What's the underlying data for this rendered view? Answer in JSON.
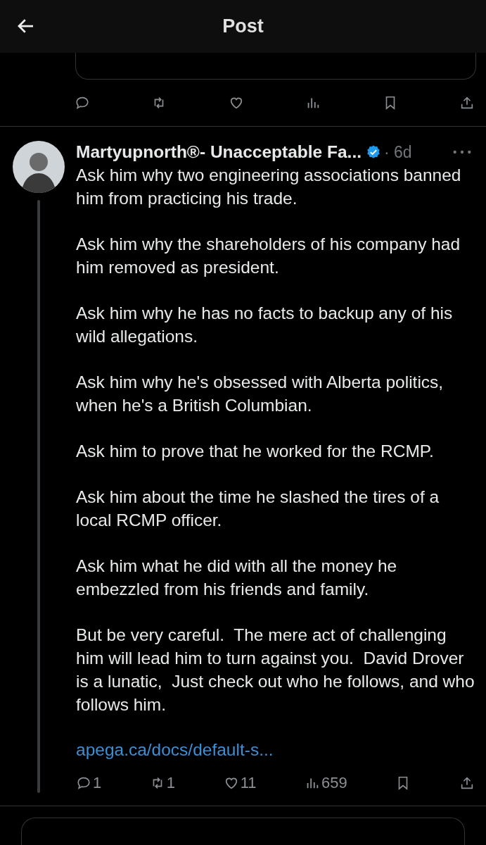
{
  "header": {
    "title": "Post"
  },
  "top_actions": [
    {
      "kind": "reply"
    },
    {
      "kind": "repost"
    },
    {
      "kind": "like"
    },
    {
      "kind": "views"
    },
    {
      "kind": "bookmark"
    },
    {
      "kind": "share"
    }
  ],
  "post": {
    "author": "Martyupnorth®- Unacceptable Fa...",
    "verified": true,
    "time": "· 6d",
    "paragraphs": [
      "Ask him why two engineering associations banned him from practicing his trade.",
      "Ask him why the shareholders of his company had him removed as president.",
      "Ask him why he has no facts to backup any of his wild allegations.",
      "Ask him why he's obsessed with Alberta politics, when he's a British Columbian.",
      "Ask him to prove that he worked for the RCMP.",
      "Ask him about the time he slashed the tires of a local RCMP officer.",
      "Ask him what he did with all the money he embezzled from his friends and family.",
      "But be very careful.  The mere act of challenging him will lead him to turn against you.  David Drover is a lunatic,  Just check out who he follows, and who follows him."
    ],
    "link": "apega.ca/docs/default-s...",
    "actions": [
      {
        "kind": "reply",
        "count": "1"
      },
      {
        "kind": "repost",
        "count": "1"
      },
      {
        "kind": "like",
        "count": "11"
      },
      {
        "kind": "views",
        "count": "659"
      },
      {
        "kind": "bookmark"
      },
      {
        "kind": "share"
      }
    ]
  }
}
